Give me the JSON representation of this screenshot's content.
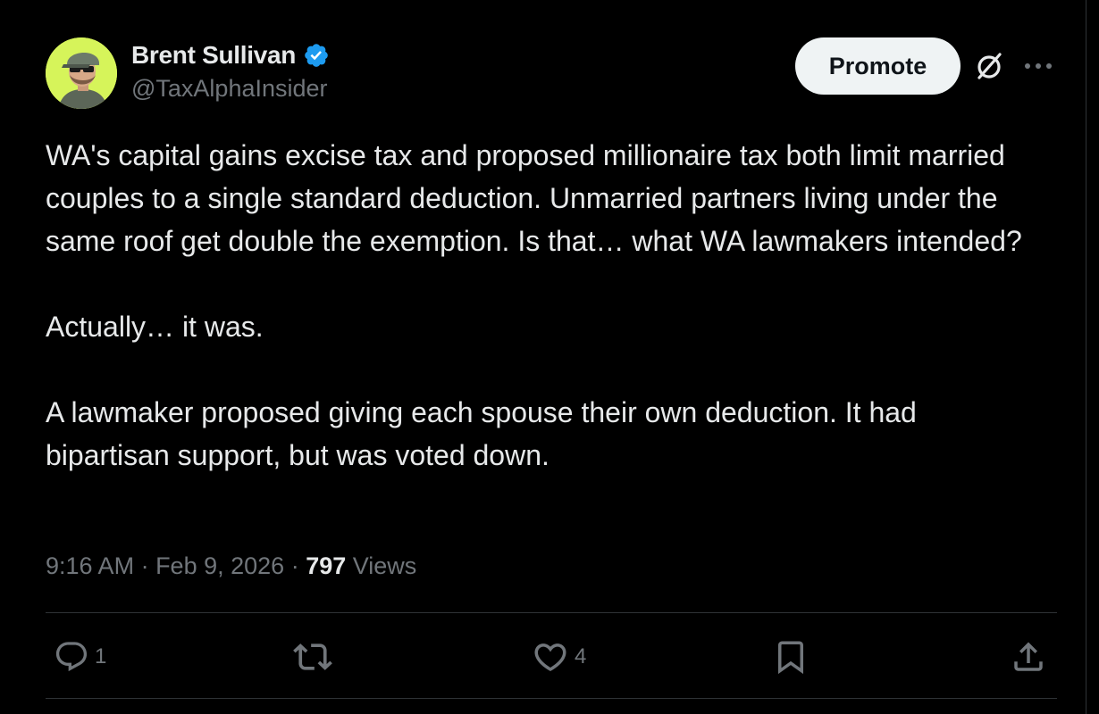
{
  "author": {
    "name": "Brent Sullivan",
    "handle": "@TaxAlphaInsider",
    "verified": true,
    "avatar_bg": "#d6f45a"
  },
  "header_actions": {
    "promote_label": "Promote",
    "grok_icon": "grok-slash-circle-icon",
    "more_icon": "more-dots-icon"
  },
  "tweet": {
    "paragraphs": [
      "WA's capital gains excise tax and proposed millionaire tax both limit married couples to a single standard deduction. Unmarried partners living under the same roof get double the exemption. Is that… what WA lawmakers intended?",
      "Actually… it was.",
      "A lawmaker proposed giving each spouse their own deduction. It had bipartisan support, but was voted down."
    ]
  },
  "meta": {
    "time": "9:16 AM",
    "separator": " · ",
    "date": "Feb 9, 2026",
    "views_count": "797",
    "views_label": "Views"
  },
  "actions": {
    "reply_count": "1",
    "retweet_count": "",
    "like_count": "4"
  },
  "colors": {
    "background": "#000000",
    "text_primary": "#e7e9ea",
    "text_secondary": "#71767b",
    "divider": "#2f3336",
    "verified_blue": "#1d9bf0",
    "button_bg": "#eff3f4"
  }
}
